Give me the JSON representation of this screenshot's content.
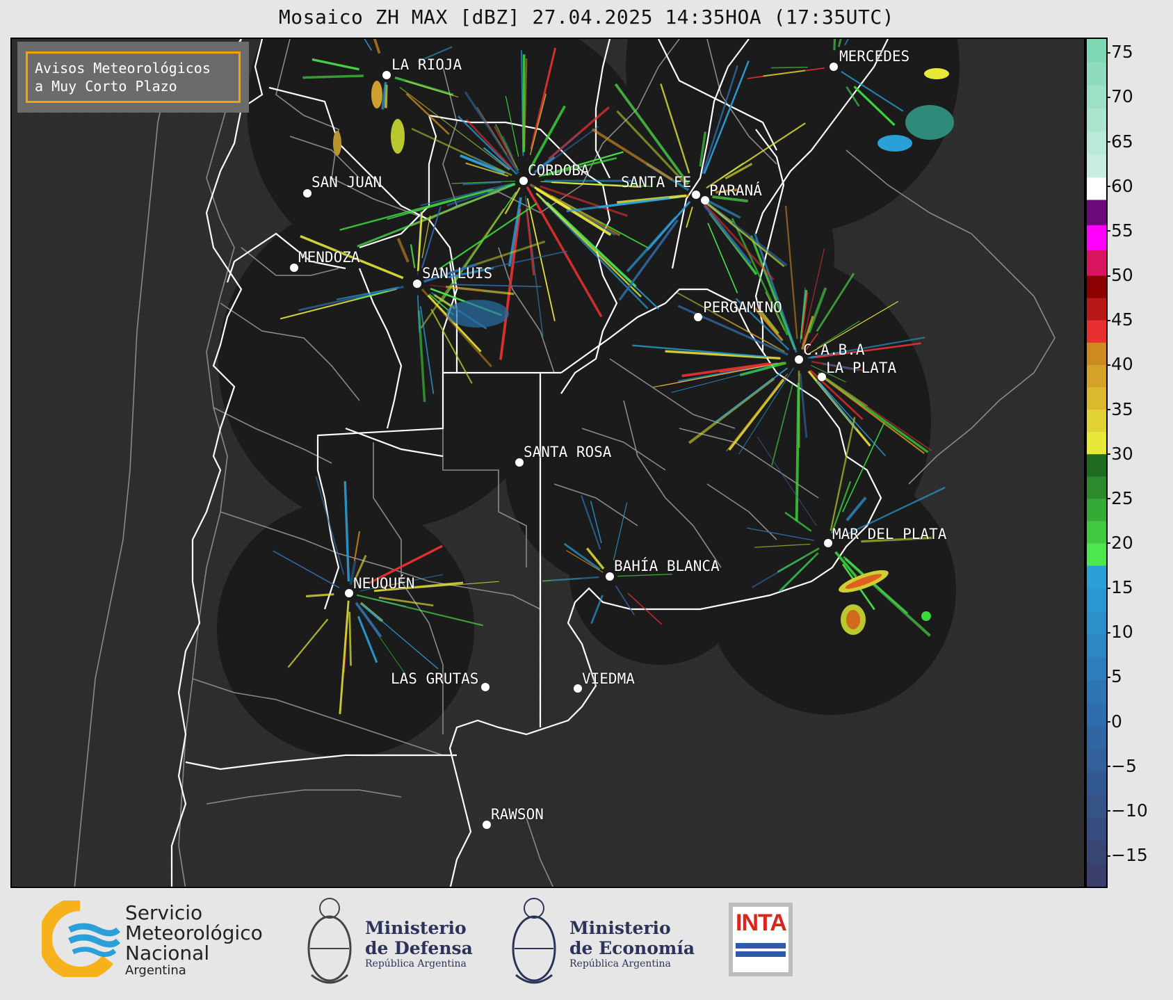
{
  "title": "Mosaico ZH MAX [dBZ] 27.04.2025 14:35HOA (17:35UTC)",
  "notice": {
    "line1": "Avisos Meteorológicos",
    "line2": "a Muy Corto Plazo"
  },
  "cities": [
    {
      "name": "LA RIOJA"
    },
    {
      "name": "MERCEDES"
    },
    {
      "name": "CORDOBA"
    },
    {
      "name": "SAN JUAN"
    },
    {
      "name": "SANTA FE"
    },
    {
      "name": "PARANÁ"
    },
    {
      "name": "MENDOZA"
    },
    {
      "name": "SAN LUIS"
    },
    {
      "name": "PERGAMINO"
    },
    {
      "name": "C.A.B.A"
    },
    {
      "name": "LA PLATA"
    },
    {
      "name": "SANTA ROSA"
    },
    {
      "name": "MAR DEL PLATA"
    },
    {
      "name": "BAHÍA BLANCA"
    },
    {
      "name": "NEUQUÉN"
    },
    {
      "name": "LAS GRUTAS"
    },
    {
      "name": "VIEDMA"
    },
    {
      "name": "RAWSON"
    }
  ],
  "colorbar": {
    "ticks": [
      "75",
      "70",
      "65",
      "60",
      "55",
      "50",
      "45",
      "40",
      "35",
      "30",
      "25",
      "20",
      "15",
      "10",
      "5",
      "0",
      "−5",
      "−10",
      "−15"
    ],
    "min": -18.5,
    "max": 76.5,
    "bands": [
      {
        "from": -18.5,
        "to": 17.5,
        "colors": [
          "#3a3f6b",
          "#2f6aa8",
          "#2a9fd8"
        ]
      },
      {
        "from": 17.5,
        "to": 30,
        "colors": [
          "#4de84d",
          "#1f6b1f"
        ]
      },
      {
        "from": 30,
        "to": 42.5,
        "colors": [
          "#e8e83a",
          "#cc8a1f"
        ]
      },
      {
        "from": 42.5,
        "to": 50,
        "colors": [
          "#e83030",
          "#8b0000"
        ]
      },
      {
        "from": 50,
        "to": 58.5,
        "colors": [
          "#d8145f",
          "#ff00ff",
          "#6a0a7a"
        ]
      },
      {
        "from": 58.5,
        "to": 61,
        "colors": [
          "#ffffff",
          "#ffffff"
        ]
      },
      {
        "from": 61,
        "to": 76.5,
        "colors": [
          "#c8eee0",
          "#7fd8b4"
        ]
      }
    ]
  },
  "logos": {
    "smn": {
      "line1": "Servicio",
      "line2": "Meteorológico",
      "line3": "Nacional",
      "line4": "Argentina"
    },
    "defensa": {
      "line1": "Ministerio",
      "line2": "de Defensa",
      "line3": "República Argentina"
    },
    "economia": {
      "line1": "Ministerio",
      "line2": "de Economía",
      "line3": "República Argentina"
    },
    "inta": {
      "text": "INTA"
    }
  }
}
